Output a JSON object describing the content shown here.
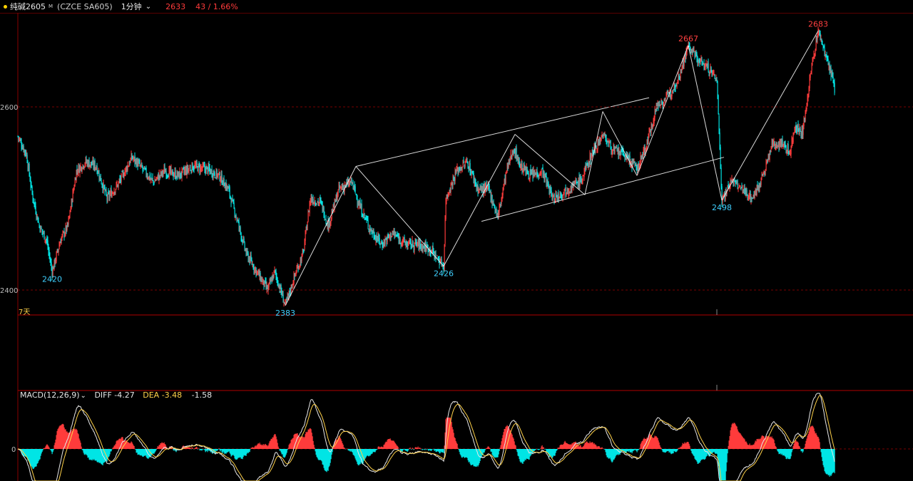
{
  "header": {
    "symbol": "纯碱2605",
    "symbol_mark": "M",
    "code": "(CZCE SA605)",
    "period": "1分钟",
    "last_price": "2633",
    "change": "43 / 1.66%"
  },
  "colors": {
    "up": "#ff3b3b",
    "down": "#00e5e5",
    "trendline": "#ffffff",
    "label_high": "#ff4040",
    "label_low": "#3fd0ff",
    "grid": "#7a0000",
    "dea": "#ffd24a"
  },
  "period_marker": "7天",
  "macd": {
    "title": "MACD(12,26,9)",
    "diff_label": "DIFF -4.27",
    "dea_label": "DEA -3.48",
    "hist_label": "-1.58"
  },
  "chart_data": {
    "type": "candlestick",
    "y_ticks": [
      2400,
      2600
    ],
    "ylim": [
      2373,
      2693
    ],
    "price_labels": [
      {
        "text": "2420",
        "price": 2420,
        "index": 48,
        "kind": "low"
      },
      {
        "text": "2383",
        "price": 2383,
        "index": 375,
        "kind": "low"
      },
      {
        "text": "2426",
        "price": 2426,
        "index": 597,
        "kind": "low"
      },
      {
        "text": "2667",
        "price": 2667,
        "index": 940,
        "kind": "high"
      },
      {
        "text": "2498",
        "price": 2498,
        "index": 987,
        "kind": "low"
      },
      {
        "text": "2683",
        "price": 2683,
        "index": 1122,
        "kind": "high"
      }
    ],
    "price_path": [
      [
        0,
        2568
      ],
      [
        12,
        2548
      ],
      [
        20,
        2505
      ],
      [
        30,
        2470
      ],
      [
        40,
        2455
      ],
      [
        48,
        2420
      ],
      [
        60,
        2455
      ],
      [
        70,
        2470
      ],
      [
        82,
        2530
      ],
      [
        95,
        2540
      ],
      [
        110,
        2535
      ],
      [
        125,
        2500
      ],
      [
        140,
        2515
      ],
      [
        160,
        2545
      ],
      [
        175,
        2532
      ],
      [
        190,
        2518
      ],
      [
        205,
        2530
      ],
      [
        225,
        2525
      ],
      [
        245,
        2535
      ],
      [
        265,
        2532
      ],
      [
        282,
        2525
      ],
      [
        295,
        2510
      ],
      [
        308,
        2475
      ],
      [
        320,
        2440
      ],
      [
        335,
        2420
      ],
      [
        350,
        2400
      ],
      [
        360,
        2420
      ],
      [
        375,
        2383
      ],
      [
        390,
        2420
      ],
      [
        400,
        2440
      ],
      [
        410,
        2500
      ],
      [
        425,
        2495
      ],
      [
        435,
        2470
      ],
      [
        450,
        2510
      ],
      [
        468,
        2518
      ],
      [
        480,
        2490
      ],
      [
        495,
        2465
      ],
      [
        510,
        2450
      ],
      [
        525,
        2462
      ],
      [
        545,
        2450
      ],
      [
        560,
        2450
      ],
      [
        578,
        2445
      ],
      [
        597,
        2426
      ],
      [
        600,
        2500
      ],
      [
        615,
        2530
      ],
      [
        630,
        2540
      ],
      [
        645,
        2510
      ],
      [
        660,
        2510
      ],
      [
        673,
        2480
      ],
      [
        685,
        2530
      ],
      [
        695,
        2555
      ],
      [
        705,
        2535
      ],
      [
        720,
        2525
      ],
      [
        735,
        2530
      ],
      [
        750,
        2500
      ],
      [
        770,
        2510
      ],
      [
        790,
        2520
      ],
      [
        805,
        2550
      ],
      [
        820,
        2570
      ],
      [
        835,
        2552
      ],
      [
        850,
        2548
      ],
      [
        868,
        2532
      ],
      [
        882,
        2560
      ],
      [
        895,
        2600
      ],
      [
        910,
        2610
      ],
      [
        925,
        2630
      ],
      [
        940,
        2667
      ],
      [
        955,
        2650
      ],
      [
        965,
        2645
      ],
      [
        980,
        2630
      ],
      [
        987,
        2498
      ],
      [
        1000,
        2520
      ],
      [
        1015,
        2510
      ],
      [
        1030,
        2500
      ],
      [
        1045,
        2525
      ],
      [
        1058,
        2560
      ],
      [
        1072,
        2560
      ],
      [
        1082,
        2550
      ],
      [
        1090,
        2580
      ],
      [
        1100,
        2570
      ],
      [
        1112,
        2640
      ],
      [
        1122,
        2683
      ],
      [
        1135,
        2650
      ],
      [
        1145,
        2620
      ]
    ],
    "trendlines": [
      [
        [
          375,
          2383
        ],
        [
          474,
          2535
        ]
      ],
      [
        [
          474,
          2535
        ],
        [
          597,
          2426
        ]
      ],
      [
        [
          597,
          2426
        ],
        [
          697,
          2570
        ]
      ],
      [
        [
          697,
          2570
        ],
        [
          795,
          2504
        ]
      ],
      [
        [
          795,
          2504
        ],
        [
          820,
          2595
        ]
      ],
      [
        [
          820,
          2595
        ],
        [
          868,
          2525
        ]
      ],
      [
        [
          868,
          2525
        ],
        [
          940,
          2667
        ]
      ],
      [
        [
          940,
          2667
        ],
        [
          987,
          2498
        ]
      ],
      [
        [
          987,
          2498
        ],
        [
          1122,
          2683
        ]
      ],
      [
        [
          474,
          2535
        ],
        [
          885,
          2610
        ]
      ],
      [
        [
          650,
          2475
        ],
        [
          990,
          2545
        ]
      ]
    ],
    "macd_zero_label": "0"
  }
}
